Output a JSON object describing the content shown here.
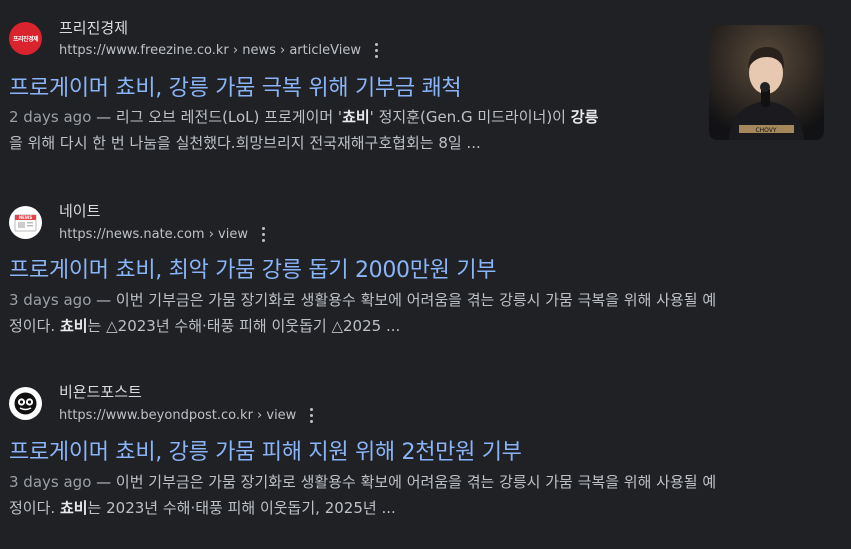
{
  "results": [
    {
      "site_name": "프리진경제",
      "logo_text": "프리진경제",
      "url": "https://www.freezine.co.kr › news › articleView",
      "title": "프로게이머 쵸비, 강릉 가뭄 극복 위해 기부금 쾌척",
      "date": "2 days ago",
      "snippet_line1_a": " — 리그 오브 레전드(LoL) 프로게이머 '",
      "snippet_line1_b": "쵸비",
      "snippet_line1_c": "' 정지훈(Gen.G 미드라이너)이 ",
      "snippet_line1_d": "강릉",
      "snippet_line2": "을 위해 다시 한 번 나눔을 실천했다.희망브리지 전국재해구호협회는 8일 ...",
      "thumbnail_caption": "CHOVY"
    },
    {
      "site_name": "네이트",
      "logo_text": "NEWS",
      "url": "https://news.nate.com › view",
      "title": "프로게이머 쵸비, 최악 가뭄 강릉 돕기 2000만원 기부",
      "date": "3 days ago",
      "snippet_line1": " — 이번 기부금은 가뭄 장기화로 생활용수 확보에 어려움을 겪는 강릉시 가뭄 극복을 위해 사용될 예",
      "snippet_line2_a": "정이다. ",
      "snippet_line2_b": "쵸비",
      "snippet_line2_c": "는 △2023년 수해·태풍 피해 이웃돕기 △2025 ..."
    },
    {
      "site_name": "비욘드포스트",
      "url": "https://www.beyondpost.co.kr › view",
      "title": "프로게이머 쵸비, 강릉 가뭄 피해 지원 위해 2천만원 기부",
      "date": "3 days ago",
      "snippet_line1": " — 이번 기부금은 가뭄 장기화로 생활용수 확보에 어려움을 겪는 강릉시 가뭄 극복을 위해 사용될 예",
      "snippet_line2_a": "정이다. ",
      "snippet_line2_b": "쵸비",
      "snippet_line2_c": "는 2023년 수해·태풍 피해 이웃돕기, 2025년 ..."
    }
  ],
  "colors": {
    "background": "#202124",
    "link": "#8ab4f8",
    "text": "#bdc1c6",
    "site_name": "#dadce0",
    "freezine_brand": "#d9232d"
  },
  "icons": [
    "more-vert-icon",
    "freezine-logo",
    "nate-news-icon",
    "beyondpost-logo"
  ]
}
